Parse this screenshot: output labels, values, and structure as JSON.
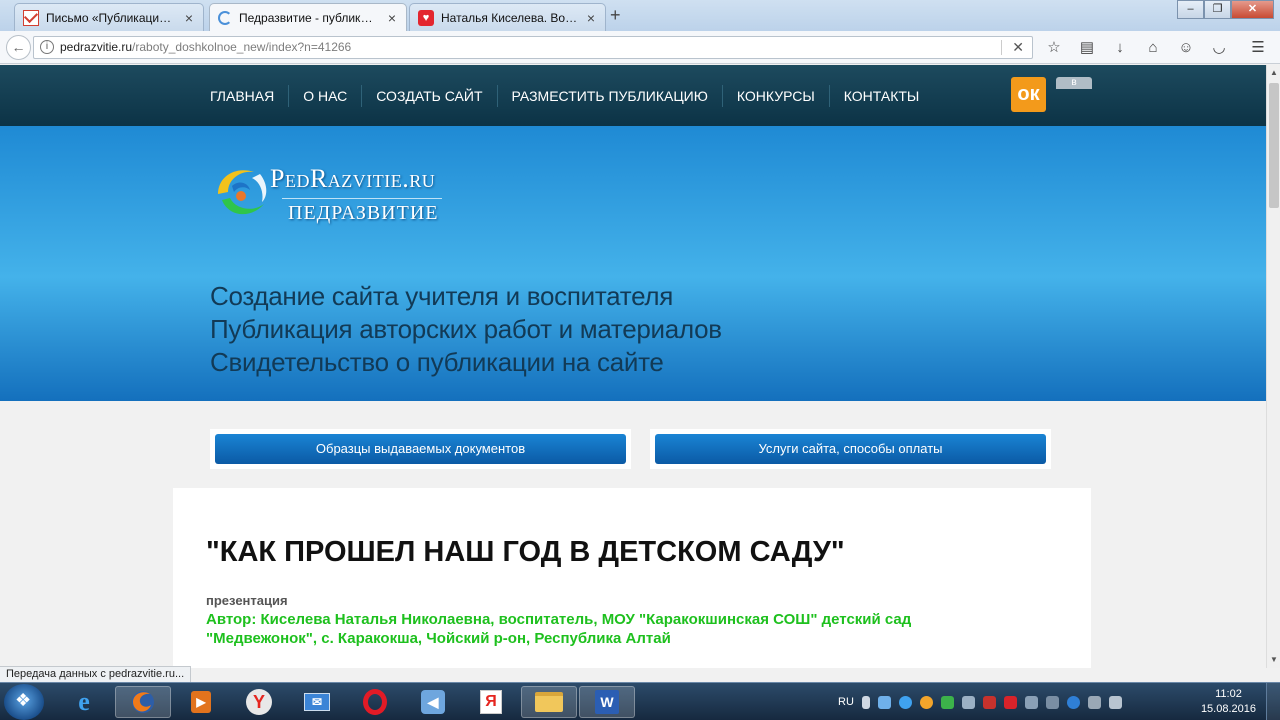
{
  "browser": {
    "tabs": [
      {
        "title": "Письмо «Публикация на ...",
        "active": false
      },
      {
        "title": "Педразвитие - публикаци...",
        "active": true
      },
      {
        "title": "Наталья Киселева. Воспи...",
        "active": false
      }
    ],
    "url_domain": "pedrazvitie.ru",
    "url_path": "/raboty_doshkolnoe_new/index?n=41266",
    "status_text": "Передача данных с pedrazvitie.ru..."
  },
  "site": {
    "menu": [
      "ГЛАВНАЯ",
      "О НАС",
      "СОЗДАТЬ САЙТ",
      "РАЗМЕСТИТЬ ПУБЛИКАЦИЮ",
      "КОНКУРСЫ",
      "КОНТАКТЫ"
    ],
    "logo_domain": "PedRazvitie.ru",
    "logo_name": "ПЕДРАЗВИТИЕ",
    "taglines": [
      "Создание сайта учителя и воспитателя",
      "Публикация авторских работ и материалов",
      "Свидетельство о публикации на сайте"
    ],
    "buttons": [
      "Образцы выдаваемых документов",
      "Услуги сайта, способы оплаты"
    ],
    "article": {
      "title": "\"КАК ПРОШЕЛ НАШ ГОД В ДЕТСКОМ САДУ\"",
      "type": "презентация",
      "author": "Автор: Киселева Наталья Николаевна, воспитатель, МОУ \"Каракокшинская СОШ\" детский сад \"Медвежонок\", с. Каракокша, Чойский р-он, Республика Алтай"
    }
  },
  "taskbar": {
    "lang": "RU",
    "time": "11:02",
    "date": "15.08.2016"
  },
  "colors": {
    "nav_bg": "#0c3346",
    "hero_blue": "#2a9ae0",
    "button_blue": "#0b5aa5",
    "author_green": "#1ec01e",
    "ok_orange": "#f39a1b"
  }
}
